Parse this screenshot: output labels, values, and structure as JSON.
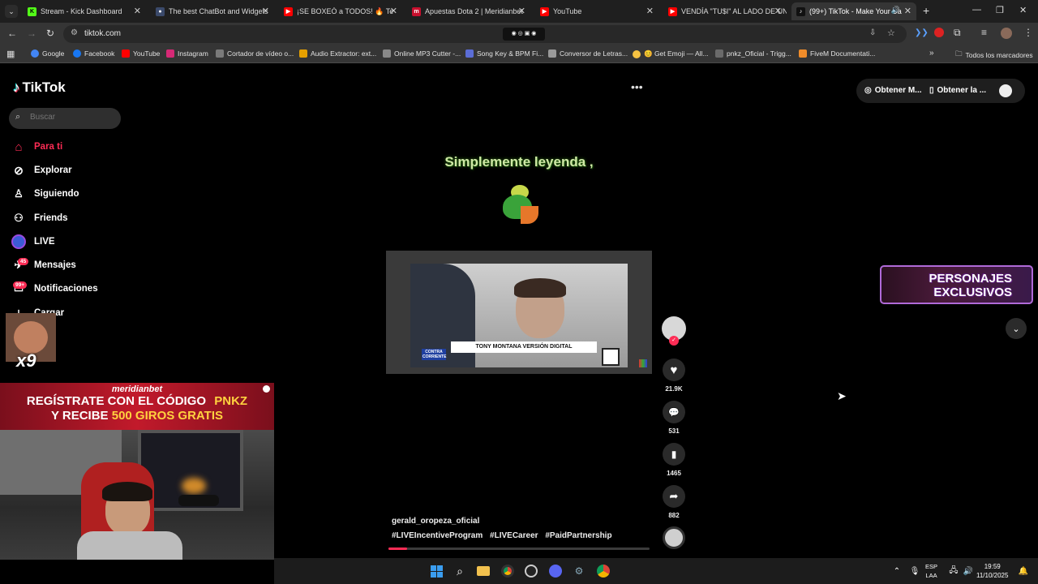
{
  "tabs": [
    {
      "title": "Stream - Kick Dashboard",
      "color": "#53fc18"
    },
    {
      "title": "The best ChatBot and Widgets",
      "color": "#3b4a6b"
    },
    {
      "title": "¡SE BOXEÓ a TODOS! 🔥 Te",
      "color": "#ff0000"
    },
    {
      "title": "Apuestas Dota 2 | Meridianbet",
      "color": "#c8102e"
    },
    {
      "title": "YouTube",
      "color": "#ff0000"
    },
    {
      "title": "VENDÍA \"TU$I\" AL LADO DE UN",
      "color": "#ff0000"
    },
    {
      "title": "(99+) TikTok - Make Your Da",
      "color": "#111111"
    }
  ],
  "address": {
    "url": "tiktok.com"
  },
  "bookmarks": [
    {
      "label": "Google",
      "color": "#4285f4"
    },
    {
      "label": "Facebook",
      "color": "#1877f2"
    },
    {
      "label": "YouTube",
      "color": "#ff0000"
    },
    {
      "label": "Instagram",
      "color": "#d62976"
    },
    {
      "label": "Cortador de vídeo o...",
      "color": "#7a7a7a"
    },
    {
      "label": "Audio Extractor: ext...",
      "color": "#e5a000"
    },
    {
      "label": "Online MP3 Cutter -...",
      "color": "#888888"
    },
    {
      "label": "Song Key & BPM Fi...",
      "color": "#5b6dd6"
    },
    {
      "label": "Conversor de Letras...",
      "color": "#9a9a9a"
    },
    {
      "label": "😊 Get Emoji — All...",
      "color": "#f5c242"
    },
    {
      "label": "pnkz_Oficial - Trigg...",
      "color": "#6a6a6a"
    },
    {
      "label": "FiveM Documentati...",
      "color": "#f08c2a"
    }
  ],
  "bookmarks_all": "Todos los marcadores",
  "sidebar": {
    "logo": "TikTok",
    "search_placeholder": "Buscar",
    "items": [
      {
        "label": "Para ti",
        "icon": "home-icon",
        "active": true
      },
      {
        "label": "Explorar",
        "icon": "compass-icon"
      },
      {
        "label": "Siguiendo",
        "icon": "following-icon"
      },
      {
        "label": "Friends",
        "icon": "friends-icon"
      },
      {
        "label": "LIVE",
        "icon": "live-icon"
      },
      {
        "label": "Mensajes",
        "icon": "messages-icon",
        "badge": "45"
      },
      {
        "label": "Notificaciones",
        "icon": "notifications-icon",
        "badge": "99+"
      },
      {
        "label": "Cargar",
        "icon": "upload-icon"
      }
    ]
  },
  "stream_overlay": {
    "emote_count": "x9",
    "promo_brand": "meridianbet",
    "promo_line1": "REGÍSTRATE CON EL CÓDIGO",
    "promo_code": "PNKZ",
    "promo_line2a": "Y RECIBE",
    "promo_line2b": "500 GIROS GRATIS"
  },
  "video": {
    "caption": "Simplemente leyenda ,",
    "lower_third": "TONY MONTANA VERSIÓN DIGITAL",
    "lower_third_tag": "CONTRA CORRIENTE",
    "author": "gerald_oropeza_oficial",
    "hashtags": [
      "#LIVEIncentiveProgram",
      "#LIVECareer",
      "#PaidPartnership"
    ],
    "progress_fraction": 0.07,
    "likes": "21.9K",
    "comments": "531",
    "saves": "1465",
    "shares": "882"
  },
  "top_right": {
    "get_app": "Obtener M...",
    "get_desktop": "Obtener la ..."
  },
  "game_banner": {
    "line1": "PERSONAJES",
    "line2": "EXCLUSIVOS"
  },
  "taskbar": {
    "lang1": "ESP",
    "lang2": "LAA",
    "time": "19:59",
    "date": "11/10/2025"
  },
  "colors": {
    "accent": "#fe2c55",
    "background": "#000000"
  }
}
